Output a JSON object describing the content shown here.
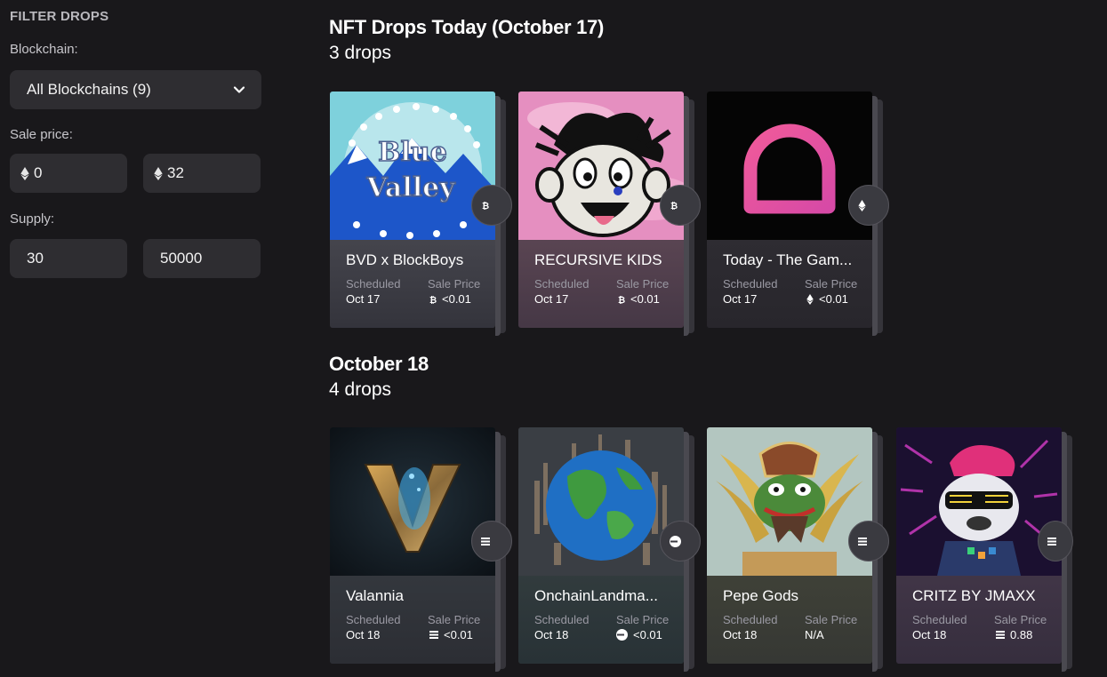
{
  "sidebar": {
    "title": "FILTER DROPS",
    "blockchain_label": "Blockchain:",
    "blockchain_value": "All Blockchains (9)",
    "sale_price_label": "Sale price:",
    "price_min": "0",
    "price_max": "32",
    "supply_label": "Supply:",
    "supply_min": "30",
    "supply_max": "50000"
  },
  "sections": [
    {
      "title": "NFT Drops Today (October 17)",
      "count": "3 drops",
      "cards": [
        {
          "name": "BVD x BlockBoys",
          "scheduled_label": "Scheduled",
          "date": "Oct 17",
          "price_label": "Sale Price",
          "price": "<0.01",
          "chain_icon": "bitcoin-icon"
        },
        {
          "name": "RECURSIVE KIDS",
          "scheduled_label": "Scheduled",
          "date": "Oct 17",
          "price_label": "Sale Price",
          "price": "<0.01",
          "chain_icon": "bitcoin-icon"
        },
        {
          "name": "Today - The Gam...",
          "scheduled_label": "Scheduled",
          "date": "Oct 17",
          "price_label": "Sale Price",
          "price": "<0.01",
          "chain_icon": "ethereum-icon"
        }
      ]
    },
    {
      "title": "October 18",
      "count": "4 drops",
      "cards": [
        {
          "name": "Valannia",
          "scheduled_label": "Scheduled",
          "date": "Oct 18",
          "price_label": "Sale Price",
          "price": "<0.01",
          "chain_icon": "solana-icon"
        },
        {
          "name": "OnchainLandma...",
          "scheduled_label": "Scheduled",
          "date": "Oct 18",
          "price_label": "Sale Price",
          "price": "<0.01",
          "chain_icon": "base-icon"
        },
        {
          "name": "Pepe Gods",
          "scheduled_label": "Scheduled",
          "date": "Oct 18",
          "price_label": "Sale Price",
          "price": "N/A",
          "chain_icon": "solana-icon"
        },
        {
          "name": "CRITZ BY JMAXX",
          "scheduled_label": "Scheduled",
          "date": "Oct 18",
          "price_label": "Sale Price",
          "price": "0.88",
          "chain_icon": "solana-icon"
        }
      ]
    }
  ],
  "blue_valley_art": {
    "line1": "Blue",
    "line2": "Valley"
  },
  "colors": {
    "background": "#19181b",
    "field": "#2e2d31",
    "card_info": "#3e3e46",
    "muted_text": "#9a99a3"
  }
}
